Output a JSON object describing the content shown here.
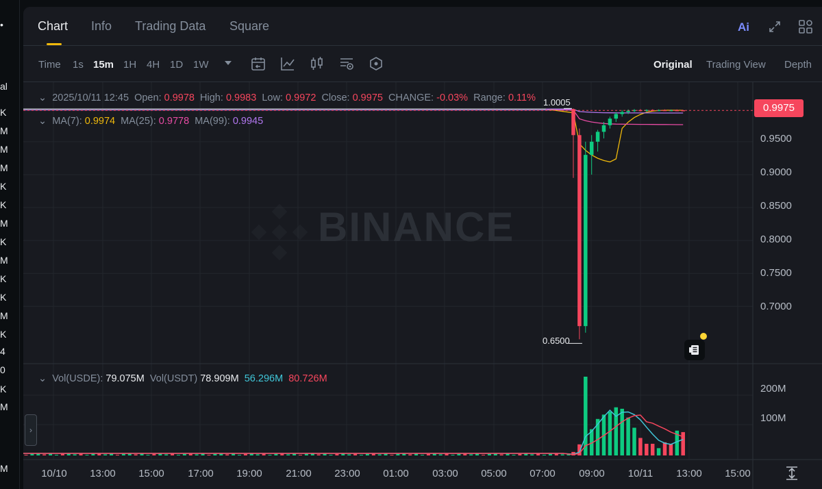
{
  "left_strip": {
    "items": [
      "•",
      "al",
      "K",
      "M",
      "M",
      "M",
      "K",
      "K",
      "M",
      "K",
      "M",
      "K",
      "K",
      "M",
      "K",
      "4",
      "0",
      "K",
      "M",
      "M"
    ]
  },
  "tabs": [
    {
      "label": "Chart",
      "active": true
    },
    {
      "label": "Info",
      "active": false
    },
    {
      "label": "Trading Data",
      "active": false
    },
    {
      "label": "Square",
      "active": false
    }
  ],
  "header_icons": {
    "ai": "Ai",
    "expand": "expand-icon",
    "layout": "layout-grid-icon"
  },
  "toolbar": {
    "timeframes": [
      "Time",
      "1s",
      "15m",
      "1H",
      "4H",
      "1D",
      "1W"
    ],
    "active_timeframe": "15m",
    "tools": [
      "chevron-down-icon",
      "calendar-icon",
      "line-indicator-icon",
      "candlestick-icon",
      "settings-list-icon",
      "hexagon-icon"
    ],
    "views": [
      "Original",
      "Trading View",
      "Depth"
    ],
    "active_view": "Original"
  },
  "candle_info": {
    "datetime": "2025/10/11 12:45",
    "open_label": "Open:",
    "open": "0.9978",
    "high_label": "High:",
    "high": "0.9983",
    "low_label": "Low:",
    "low": "0.9972",
    "close_label": "Close:",
    "close": "0.9975",
    "change_label": "CHANGE:",
    "change": "-0.03%",
    "range_label": "Range:",
    "range": "0.11%"
  },
  "ma_info": {
    "ma7_label": "MA(7):",
    "ma7": "0.9974",
    "ma25_label": "MA(25):",
    "ma25": "0.9778",
    "ma99_label": "MA(99):",
    "ma99": "0.9945"
  },
  "vol_info": {
    "usde_label": "Vol(USDE):",
    "usde": "79.075M",
    "usdt_label": "Vol(USDT)",
    "usdt": "78.909M",
    "ma1": "56.296M",
    "ma2": "80.726M"
  },
  "current_price": "0.9975",
  "max_label": "1.0005",
  "min_label": "0.6500",
  "watermark": "BINANCE",
  "y_ticks": [
    "0.9500",
    "0.9000",
    "0.8500",
    "0.8000",
    "0.7500",
    "0.7000"
  ],
  "vol_ticks": [
    "200M",
    "100M"
  ],
  "x_ticks": [
    "10/10",
    "13:00",
    "15:00",
    "17:00",
    "19:00",
    "21:00",
    "23:00",
    "01:00",
    "03:00",
    "05:00",
    "07:00",
    "09:00",
    "10/11",
    "13:00",
    "15:00"
  ],
  "colors": {
    "up": "#0ecb81",
    "down": "#f6465d",
    "ma7": "#f0b90b",
    "ma25": "#e84ba4",
    "ma99": "#b277f0",
    "vol_ma1": "#40c6d8",
    "vol_ma2": "#f6465d",
    "accent": "#f0b90b"
  },
  "chart_data": {
    "type": "candlestick",
    "y_range": [
      0.64,
      1.005
    ],
    "candles": [
      {
        "t": "08:15",
        "o": 0.9995,
        "h": 1.0005,
        "l": 0.895,
        "c": 0.96
      },
      {
        "t": "08:30",
        "o": 0.96,
        "h": 0.97,
        "l": 0.65,
        "c": 0.67
      },
      {
        "t": "08:45",
        "o": 0.67,
        "h": 0.95,
        "l": 0.66,
        "c": 0.93
      },
      {
        "t": "09:00",
        "o": 0.93,
        "h": 0.96,
        "l": 0.9,
        "c": 0.95
      },
      {
        "t": "09:15",
        "o": 0.95,
        "h": 0.968,
        "l": 0.935,
        "c": 0.965
      },
      {
        "t": "09:30",
        "o": 0.965,
        "h": 0.98,
        "l": 0.955,
        "c": 0.975
      },
      {
        "t": "09:45",
        "o": 0.975,
        "h": 0.988,
        "l": 0.97,
        "c": 0.985
      },
      {
        "t": "10:00",
        "o": 0.985,
        "h": 0.995,
        "l": 0.98,
        "c": 0.992
      },
      {
        "t": "10:15",
        "o": 0.992,
        "h": 0.998,
        "l": 0.988,
        "c": 0.995
      },
      {
        "t": "10:30",
        "o": 0.995,
        "h": 0.999,
        "l": 0.992,
        "c": 0.997
      },
      {
        "t": "10:45",
        "o": 0.997,
        "h": 0.9995,
        "l": 0.995,
        "c": 0.998
      },
      {
        "t": "11:00",
        "o": 0.998,
        "h": 0.9995,
        "l": 0.996,
        "c": 0.9975
      },
      {
        "t": "11:15",
        "o": 0.9975,
        "h": 0.999,
        "l": 0.996,
        "c": 0.9982
      },
      {
        "t": "11:30",
        "o": 0.9982,
        "h": 0.9992,
        "l": 0.9968,
        "c": 0.9976
      },
      {
        "t": "11:45",
        "o": 0.9976,
        "h": 0.999,
        "l": 0.9965,
        "c": 0.998
      },
      {
        "t": "12:00",
        "o": 0.998,
        "h": 0.999,
        "l": 0.997,
        "c": 0.9974
      },
      {
        "t": "12:15",
        "o": 0.9974,
        "h": 0.9988,
        "l": 0.9966,
        "c": 0.9979
      },
      {
        "t": "12:30",
        "o": 0.9979,
        "h": 0.999,
        "l": 0.997,
        "c": 0.9978
      },
      {
        "t": "12:45",
        "o": 0.9978,
        "h": 0.9983,
        "l": 0.9972,
        "c": 0.9975
      }
    ],
    "volume_candles": [
      12,
      38,
      270,
      90,
      125,
      140,
      150,
      165,
      160,
      130,
      95,
      60,
      40,
      40,
      25,
      45,
      40,
      85,
      80
    ],
    "volume_up": [
      false,
      false,
      true,
      true,
      true,
      true,
      true,
      true,
      true,
      true,
      true,
      false,
      false,
      false,
      true,
      false,
      false,
      true,
      false
    ],
    "volume_ylim": [
      0,
      270
    ],
    "flat_price": 0.9995
  }
}
